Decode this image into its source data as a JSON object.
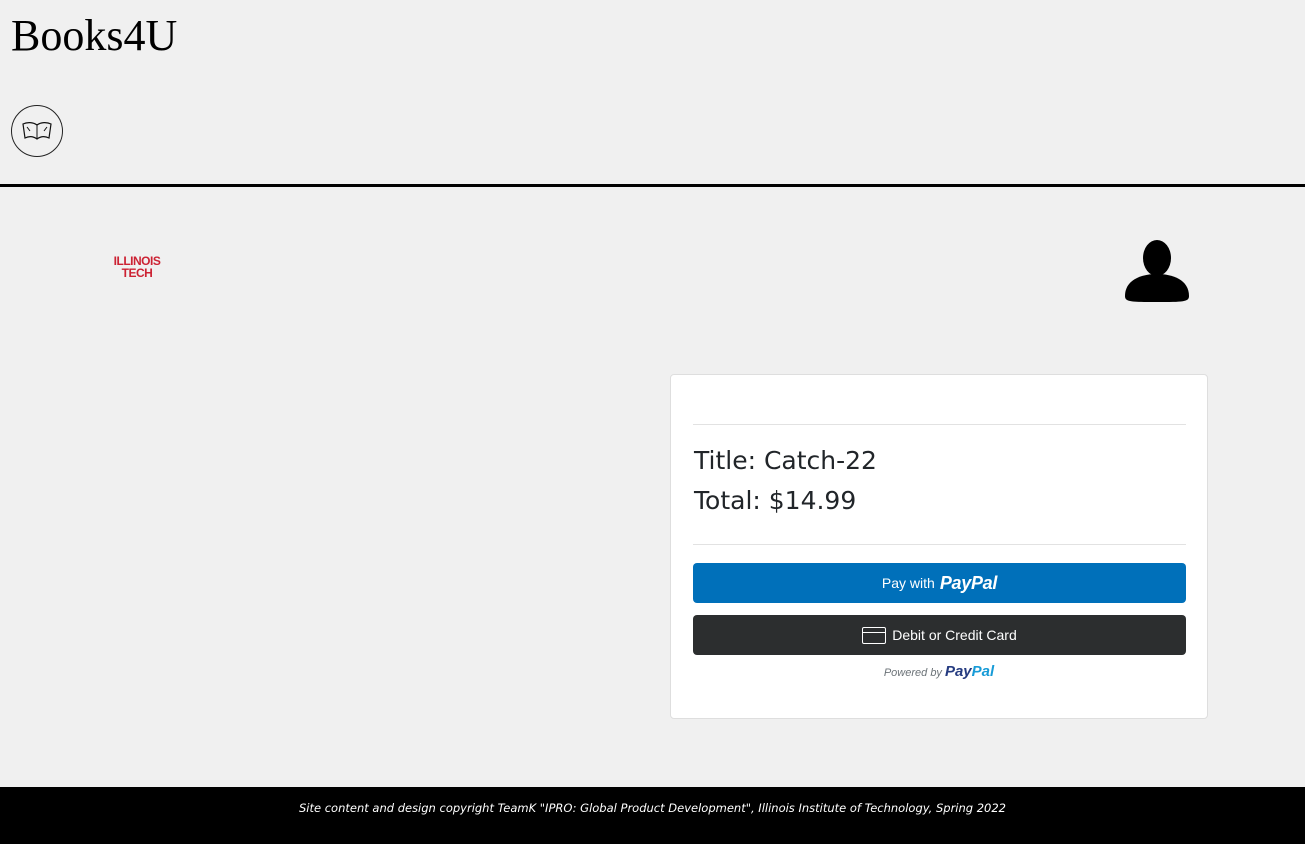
{
  "site": {
    "title": "Books4U",
    "logo_icon": "book-icon"
  },
  "header": {
    "school_logo_line1": "ILLINOIS",
    "school_logo_line2": "TECH",
    "school_logo_color": "#cc2233",
    "user_icon": "user-icon"
  },
  "checkout": {
    "title_line": "Title: Catch-22",
    "total_line": "Total: $14.99",
    "paypal_button_prefix": "Pay with",
    "paypal_button_brand": "PayPal",
    "paypal_button_color": "#0070ba",
    "card_button_label": "Debit or Credit Card",
    "card_button_color": "#2c2e2f",
    "powered_by_text": "Powered by",
    "powered_by_brand_pay": "Pay",
    "powered_by_brand_pal": "Pal"
  },
  "footer": {
    "text": "Site content and design copyright TeamK \"IPRO: Global Product Development\", Illinois Institute of Technology, Spring 2022"
  }
}
